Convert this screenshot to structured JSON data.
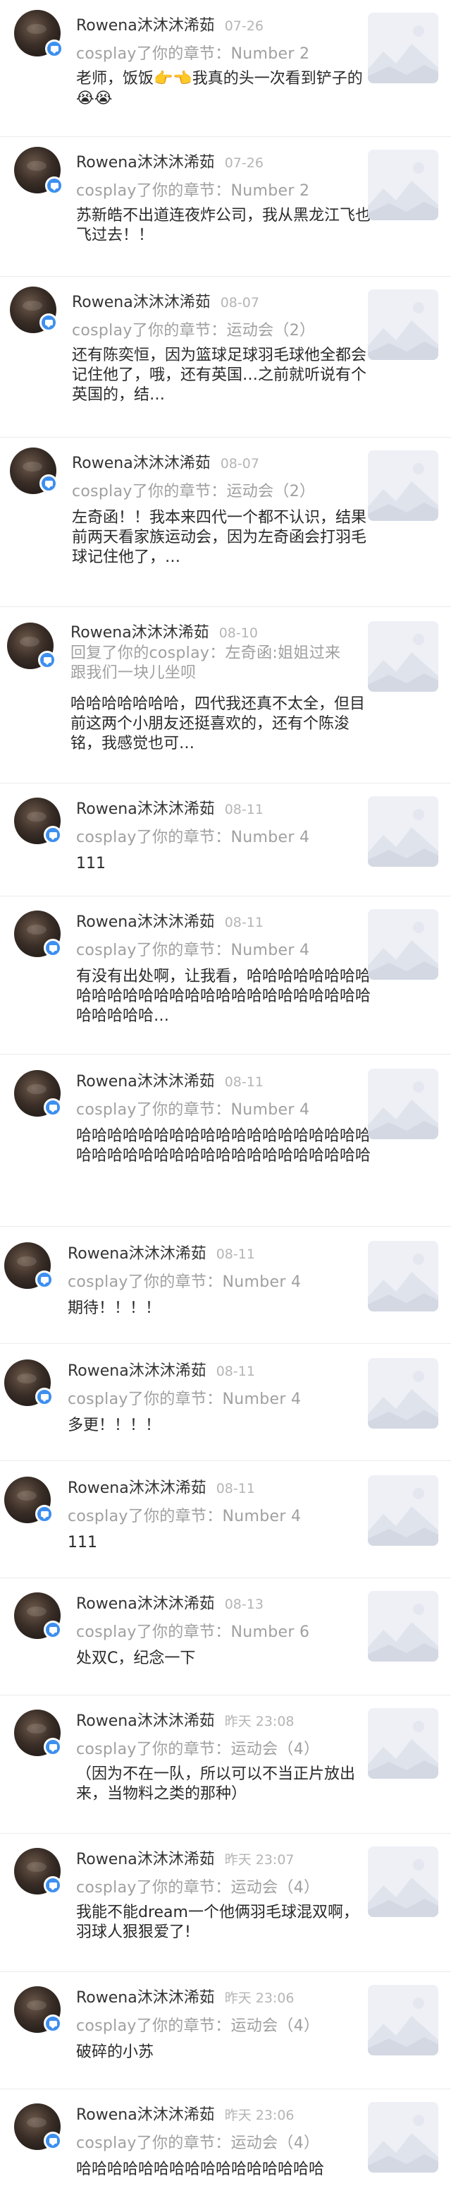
{
  "comments": [
    {
      "name": "Rowena沐沐沐浠茹",
      "date": "07-26",
      "chapter": "cosplay了你的章节：Number 2",
      "body": "老师，饭饭👉👈我真的头一次看到铲子的😭😭"
    },
    {
      "name": "Rowena沐沐沐浠茹",
      "date": "07-26",
      "chapter": "cosplay了你的章节：Number 2",
      "body": "苏新皓不出道连夜炸公司，我从黑龙江飞也飞过去！！"
    },
    {
      "name": "Rowena沐沐沐浠茹",
      "date": "08-07",
      "chapter": "cosplay了你的章节：运动会（2）",
      "body": "还有陈奕恒，因为篮球足球羽毛球他全都会记住他了，哦，还有英国…之前就听说有个英国的，结…"
    },
    {
      "name": "Rowena沐沐沐浠茹",
      "date": "08-07",
      "chapter": "cosplay了你的章节：运动会（2）",
      "body": "左奇函！！我本来四代一个都不认识，结果前两天看家族运动会，因为左奇函会打羽毛球记住他了，…"
    },
    {
      "name": "Rowena沐沐沐浠茹",
      "date": "08-10",
      "chapter": "回复了你的cosplay：左奇函:姐姐过来跟我们一块儿坐呗",
      "body": "哈哈哈哈哈哈哈，四代我还真不太全，但目前这两个小朋友还挺喜欢的，还有个陈浚铭，我感觉也可…"
    },
    {
      "name": "Rowena沐沐沐浠茹",
      "date": "08-11",
      "chapter": "cosplay了你的章节：Number 4",
      "body": "111"
    },
    {
      "name": "Rowena沐沐沐浠茹",
      "date": "08-11",
      "chapter": "cosplay了你的章节：Number 4",
      "body": "有没有出处啊，让我看，哈哈哈哈哈哈哈哈哈哈哈哈哈哈哈哈哈哈哈哈哈哈哈哈哈哈哈哈哈哈哈哈…"
    },
    {
      "name": "Rowena沐沐沐浠茹",
      "date": "08-11",
      "chapter": "cosplay了你的章节：Number 4",
      "body": "哈哈哈哈哈哈哈哈哈哈哈哈哈哈哈哈哈哈哈哈哈哈哈哈哈哈哈哈哈哈哈哈哈哈哈哈哈哈"
    },
    {
      "name": "Rowena沐沐沐浠茹",
      "date": "08-11",
      "chapter": "cosplay了你的章节：Number 4",
      "body": "期待！！！！"
    },
    {
      "name": "Rowena沐沐沐浠茹",
      "date": "08-11",
      "chapter": "cosplay了你的章节：Number 4",
      "body": "多更！！！！"
    },
    {
      "name": "Rowena沐沐沐浠茹",
      "date": "08-11",
      "chapter": "cosplay了你的章节：Number 4",
      "body": "111"
    },
    {
      "name": "Rowena沐沐沐浠茹",
      "date": "08-13",
      "chapter": "cosplay了你的章节：Number 6",
      "body": "处双C，纪念一下"
    },
    {
      "name": "Rowena沐沐沐浠茹",
      "date": "昨天 23:08",
      "chapter": "cosplay了你的章节：运动会（4）",
      "body": "（因为不在一队，所以可以不当正片放出来，当物料之类的那种）"
    },
    {
      "name": "Rowena沐沐沐浠茹",
      "date": "昨天 23:07",
      "chapter": "cosplay了你的章节：运动会（4）",
      "body": "我能不能dream一个他俩羽毛球混双啊，羽球人狠狠爱了!"
    },
    {
      "name": "Rowena沐沐沐浠茹",
      "date": "昨天 23:06",
      "chapter": "cosplay了你的章节：运动会（4）",
      "body": "破碎的小苏"
    },
    {
      "name": "Rowena沐沐沐浠茹",
      "date": "昨天 23:06",
      "chapter": "cosplay了你的章节：运动会（4）",
      "body": "哈哈哈哈哈哈哈哈哈哈哈哈哈哈哈哈"
    }
  ]
}
